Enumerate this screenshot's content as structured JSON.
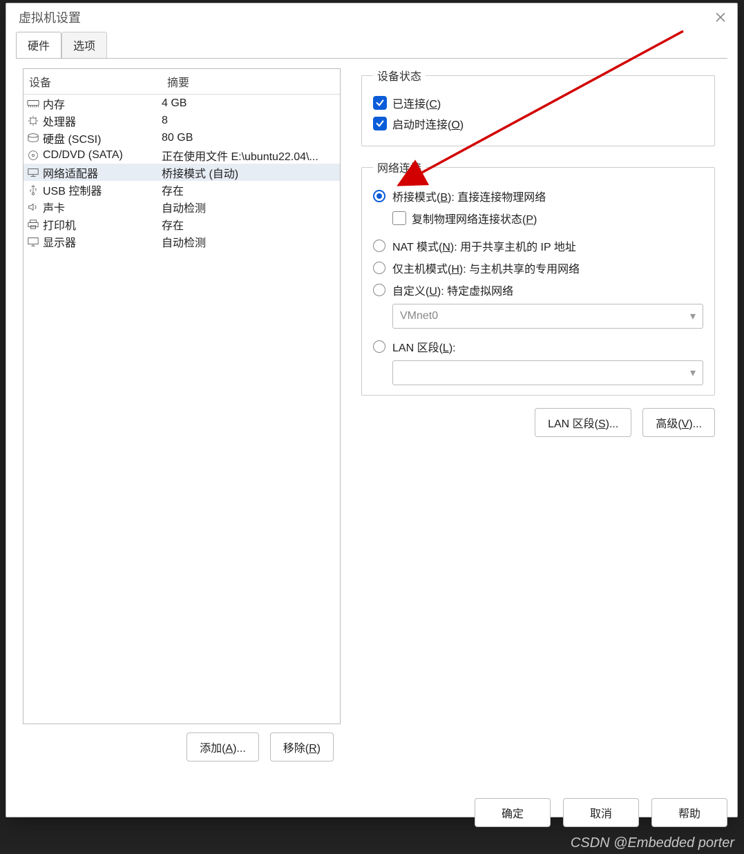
{
  "title": "虚拟机设置",
  "tabs": {
    "hardware": "硬件",
    "options": "选项"
  },
  "table": {
    "h_device": "设备",
    "h_summary": "摘要",
    "rows": [
      {
        "icon": "memory-icon",
        "name": "内存",
        "summary": "4 GB"
      },
      {
        "icon": "cpu-icon",
        "name": "处理器",
        "summary": "8"
      },
      {
        "icon": "disk-icon",
        "name": "硬盘 (SCSI)",
        "summary": "80 GB"
      },
      {
        "icon": "cd-icon",
        "name": "CD/DVD (SATA)",
        "summary": "正在使用文件 E:\\ubuntu22.04\\..."
      },
      {
        "icon": "network-icon",
        "name": "网络适配器",
        "summary": "桥接模式 (自动)"
      },
      {
        "icon": "usb-icon",
        "name": "USB 控制器",
        "summary": "存在"
      },
      {
        "icon": "sound-icon",
        "name": "声卡",
        "summary": "自动检测"
      },
      {
        "icon": "printer-icon",
        "name": "打印机",
        "summary": "存在"
      },
      {
        "icon": "display-icon",
        "name": "显示器",
        "summary": "自动检测"
      }
    ],
    "selected_index": 4
  },
  "device_status": {
    "legend": "设备状态",
    "connected_label_pre": "已连接(",
    "connected_hot": "C",
    "connected_label_post": ")",
    "connect_at_poweron_pre": "启动时连接(",
    "connect_at_poweron_hot": "O",
    "connect_at_poweron_post": ")"
  },
  "network": {
    "legend": "网络连接",
    "bridged_pre": "桥接模式(",
    "bridged_hot": "B",
    "bridged_post": "): 直接连接物理网络",
    "replicate_pre": "复制物理网络连接状态(",
    "replicate_hot": "P",
    "replicate_post": ")",
    "nat_pre": "NAT 模式(",
    "nat_hot": "N",
    "nat_post": "): 用于共享主机的 IP 地址",
    "hostonly_pre": "仅主机模式(",
    "hostonly_hot": "H",
    "hostonly_post": "): 与主机共享的专用网络",
    "custom_pre": "自定义(",
    "custom_hot": "U",
    "custom_post": "): 特定虚拟网络",
    "custom_select": "VMnet0",
    "lanseg_pre": "LAN 区段(",
    "lanseg_hot": "L",
    "lanseg_post": ":",
    "lanseg_select": ""
  },
  "right_buttons": {
    "lan_pre": "LAN 区段(",
    "lan_hot": "S",
    "lan_post": ")...",
    "adv_pre": "高级(",
    "adv_hot": "V",
    "adv_post": ")..."
  },
  "left_buttons": {
    "add_pre": "添加(",
    "add_hot": "A",
    "add_post": ")...",
    "remove_pre": "移除(",
    "remove_hot": "R",
    "remove_post": ")"
  },
  "footer": {
    "ok": "确定",
    "cancel": "取消",
    "help": "帮助"
  },
  "watermark": "CSDN @Embedded porter"
}
